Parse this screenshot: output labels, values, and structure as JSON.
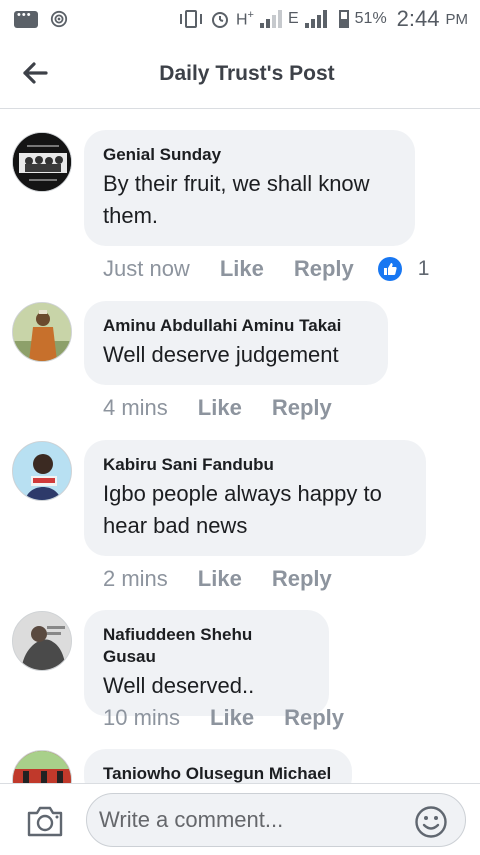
{
  "status_bar": {
    "network_label": "H",
    "network_sup": "+",
    "network2_label": "E",
    "battery": "51%",
    "time": "2:44",
    "ampm": "PM"
  },
  "header": {
    "title": "Daily Trust's Post"
  },
  "comments": [
    {
      "author": "Genial Sunday",
      "text": "By their fruit, we shall know them.",
      "time": "Just now",
      "like": "Like",
      "reply": "Reply",
      "reaction_count": "1"
    },
    {
      "author": "Aminu Abdullahi Aminu Takai",
      "text": "Well deserve judgement",
      "time": "4 mins",
      "like": "Like",
      "reply": "Reply"
    },
    {
      "author": "Kabiru Sani Fandubu",
      "text": "Igbo people always happy to hear bad news",
      "time": "2 mins",
      "like": "Like",
      "reply": "Reply"
    },
    {
      "author": "Nafiuddeen Shehu Gusau",
      "text": "Well deserved..",
      "time": "10 mins",
      "like": "Like",
      "reply": "Reply"
    },
    {
      "author": "Taniowho Olusegun Michael"
    }
  ],
  "composer": {
    "placeholder": "Write a comment..."
  },
  "colors": {
    "accent": "#1877f2",
    "bubble": "#f0f2f5",
    "meta": "#8d949e"
  }
}
